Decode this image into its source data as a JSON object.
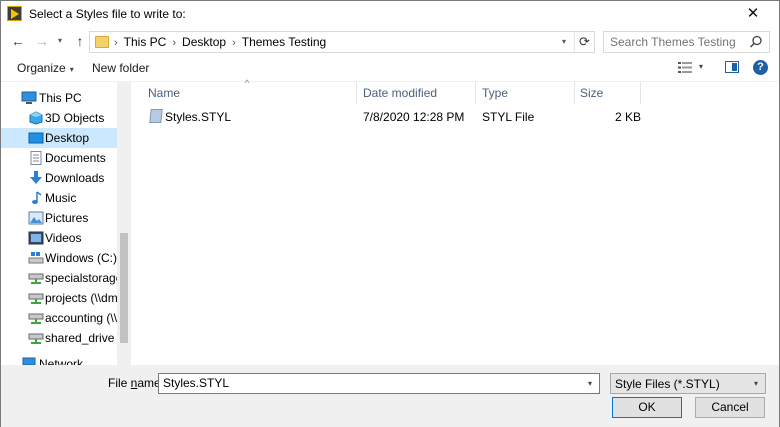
{
  "window": {
    "title": "Select a Styles file to write to:",
    "close_glyph": "✕"
  },
  "navigation": {
    "back_glyph": "←",
    "forward_glyph": "→",
    "recent_glyph": "▾",
    "up_glyph": "↑",
    "breadcrumbs": [
      "This PC",
      "Desktop",
      "Themes Testing"
    ],
    "separator": "›",
    "address_drop_glyph": "▾",
    "refresh_glyph": "⟳",
    "search_placeholder": "Search Themes Testing"
  },
  "commands": {
    "organize": "Organize",
    "new_folder": "New folder",
    "view_caret": "▾",
    "help": "?"
  },
  "sidebar": {
    "items": [
      {
        "label": "This PC",
        "icon": "computer-icon"
      },
      {
        "label": "3D Objects",
        "icon": "cube-icon"
      },
      {
        "label": "Desktop",
        "icon": "desktop-icon"
      },
      {
        "label": "Documents",
        "icon": "document-icon"
      },
      {
        "label": "Downloads",
        "icon": "download-icon"
      },
      {
        "label": "Music",
        "icon": "music-icon"
      },
      {
        "label": "Pictures",
        "icon": "picture-icon"
      },
      {
        "label": "Videos",
        "icon": "video-icon"
      },
      {
        "label": "Windows (C:)",
        "icon": "drive-icon"
      },
      {
        "label": "specialstorage (\\\\",
        "icon": "network-drive-icon"
      },
      {
        "label": "projects (\\\\dmc-",
        "icon": "network-drive-icon"
      },
      {
        "label": "accounting (\\\\di",
        "icon": "network-drive-icon"
      },
      {
        "label": "shared_drive (\\\\c",
        "icon": "network-drive-icon"
      },
      {
        "label": "Network",
        "icon": "network-icon"
      }
    ],
    "selected": "Desktop"
  },
  "file_list": {
    "columns": [
      "Name",
      "Date modified",
      "Type",
      "Size"
    ],
    "sort_glyph": "^",
    "rows": [
      {
        "name": "Styles.STYL",
        "date": "7/8/2020 12:28 PM",
        "type": "STYL File",
        "size": "2 KB"
      }
    ]
  },
  "footer": {
    "file_name_label_pre": "File ",
    "file_name_label_u": "n",
    "file_name_label_post": "ame:",
    "file_name_value": "Styles.STYL",
    "file_type": "Style Files (*.STYL)",
    "drop_glyph": "▾",
    "ok_label": "OK",
    "cancel_label": "Cancel"
  },
  "colors": {
    "selection": "#cce8ff",
    "accent": "#0078d7",
    "help_blue": "#1f5fa8"
  }
}
